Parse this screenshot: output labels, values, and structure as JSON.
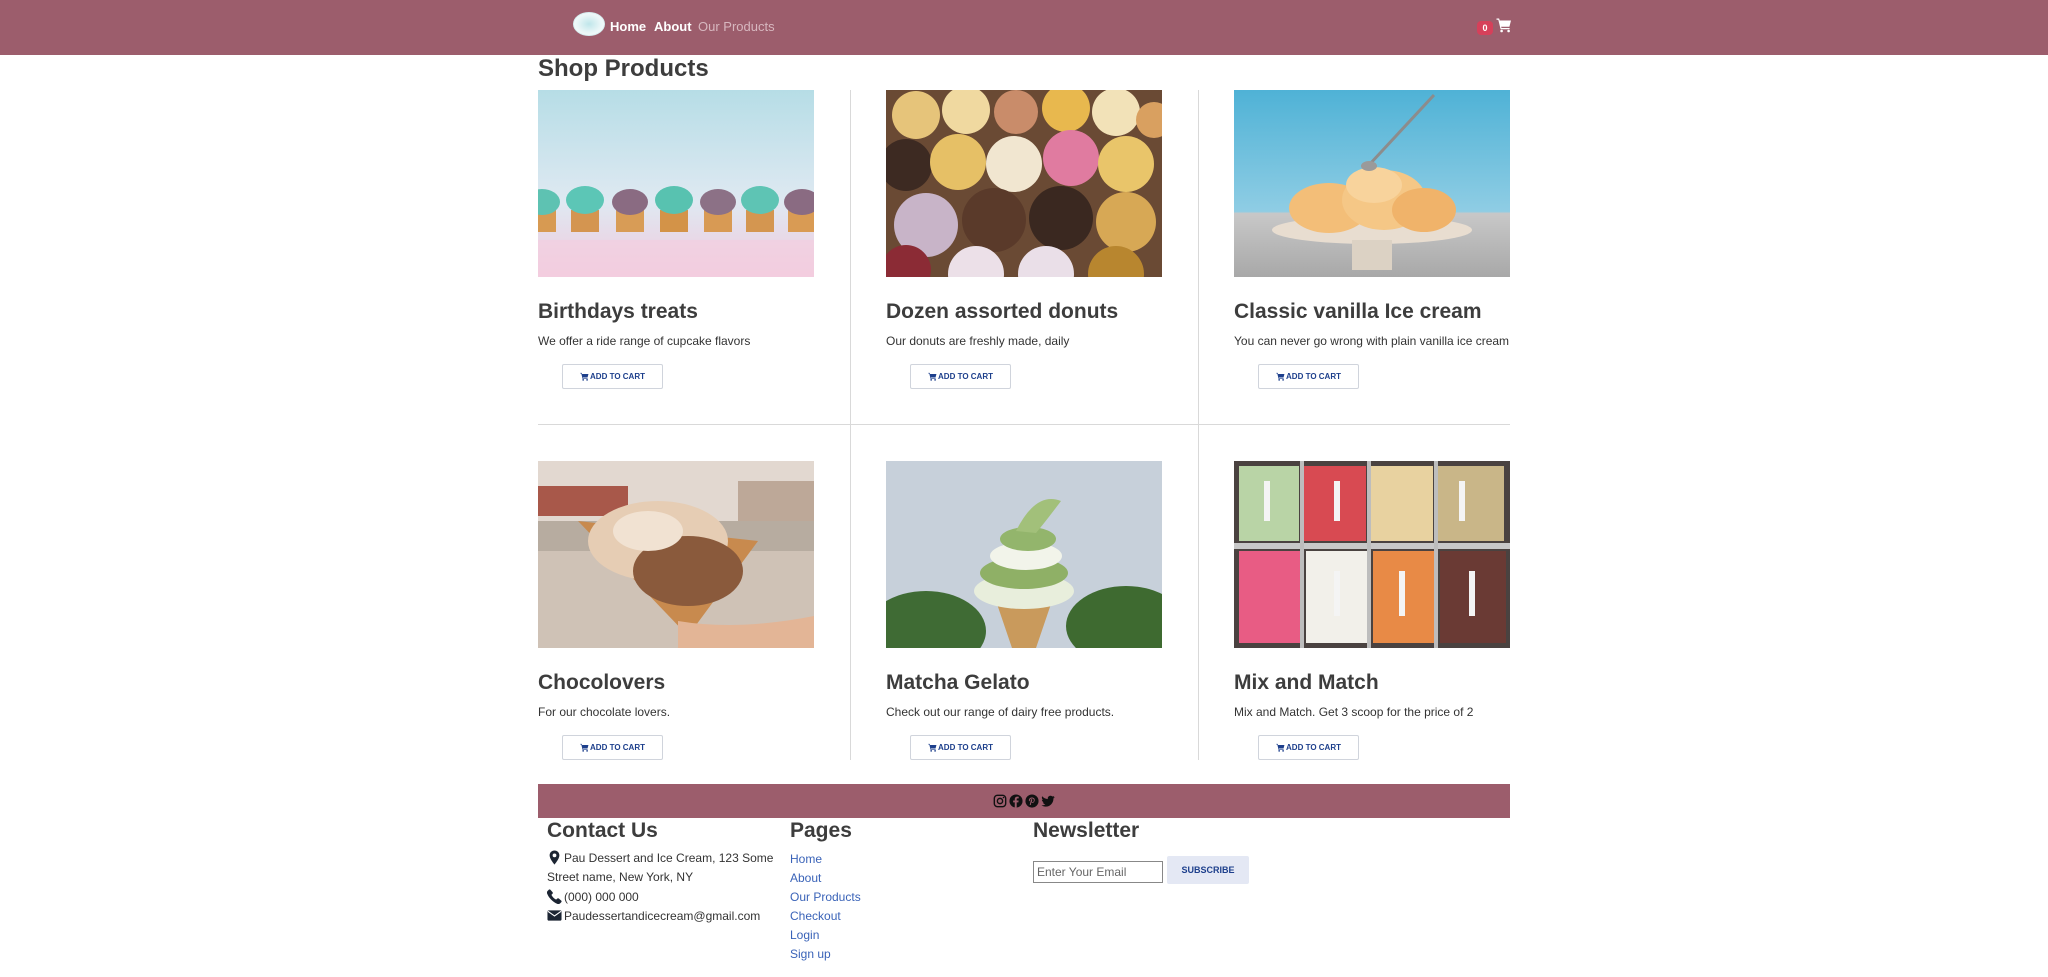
{
  "nav": {
    "links": [
      {
        "label": "Home"
      },
      {
        "label": "About"
      },
      {
        "label": "Our Products"
      }
    ],
    "cart_count": "0",
    "color": "#9c5d6c"
  },
  "page_title": "Shop Products",
  "add_to_cart_label": "ADD TO CART",
  "products": [
    {
      "title": "Birthdays treats",
      "description": "We offer a ride range of cupcake flavors",
      "image": "cupcakes"
    },
    {
      "title": "Dozen assorted donuts",
      "description": "Our donuts are freshly made, daily",
      "image": "donuts"
    },
    {
      "title": "Classic vanilla Ice cream",
      "description": "You can never go wrong with plain vanilla ice cream",
      "image": "vanilla-ice-cream"
    },
    {
      "title": "Chocolovers",
      "description": "For our chocolate lovers.",
      "image": "chocolate-ice-cream-cone"
    },
    {
      "title": "Matcha Gelato",
      "description": "Check out our range of dairy free products.",
      "image": "matcha-soft-serve"
    },
    {
      "title": "Mix and Match",
      "description": "Mix and Match. Get 3 scoop for the price of 2",
      "image": "gelato-display"
    }
  ],
  "social_icons": [
    "instagram-icon",
    "facebook-icon",
    "pinterest-icon",
    "twitter-icon"
  ],
  "footer": {
    "contact": {
      "heading": "Contact Us",
      "address_line1": "Pau Dessert and Ice Cream, 123 Some",
      "address_line2": "Street name, New York, NY",
      "phone": "(000) 000 000",
      "email": "Paudessertandicecream@gmail.com"
    },
    "pages": {
      "heading": "Pages",
      "links": [
        "Home",
        "About",
        "Our Products",
        "Checkout",
        "Login",
        "Sign up"
      ]
    },
    "newsletter": {
      "heading": "Newsletter",
      "placeholder": "Enter Your Email",
      "button": "SUBSCRIBE"
    }
  }
}
